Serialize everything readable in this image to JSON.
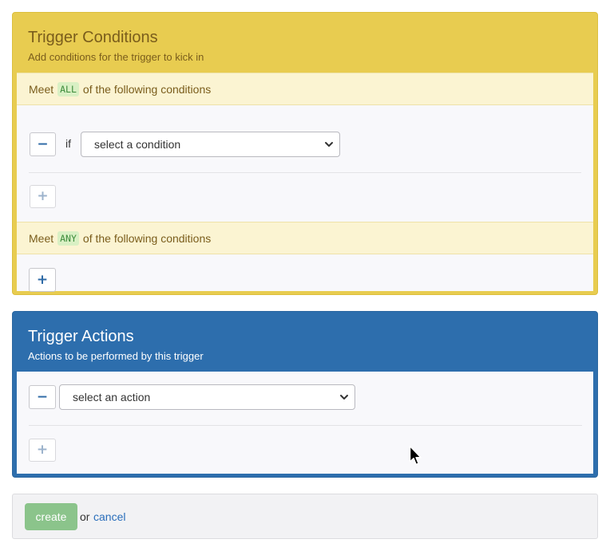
{
  "conditions": {
    "title": "Trigger Conditions",
    "subtitle": "Add conditions for the trigger to kick in",
    "all_group": {
      "prefix": "Meet",
      "tag": "ALL",
      "suffix": "of the following conditions",
      "remove_label": "−",
      "if_label": "if",
      "select_value": "select a condition",
      "add_label": "+"
    },
    "any_group": {
      "prefix": "Meet",
      "tag": "ANY",
      "suffix": "of the following conditions",
      "add_label": "+"
    }
  },
  "actions": {
    "title": "Trigger Actions",
    "subtitle": "Actions to be performed by this trigger",
    "remove_label": "−",
    "select_value": "select an action",
    "add_label": "+"
  },
  "footer": {
    "create_label": "create",
    "or_text": "or",
    "cancel_label": "cancel"
  },
  "colors": {
    "conditions_header": "#e8cc50",
    "actions_header": "#2d6ead",
    "create_button": "#8bc48b",
    "link": "#2a6ebb"
  },
  "icons": [
    "minus-icon",
    "plus-icon",
    "chevron-down-icon",
    "mouse-pointer-icon"
  ]
}
